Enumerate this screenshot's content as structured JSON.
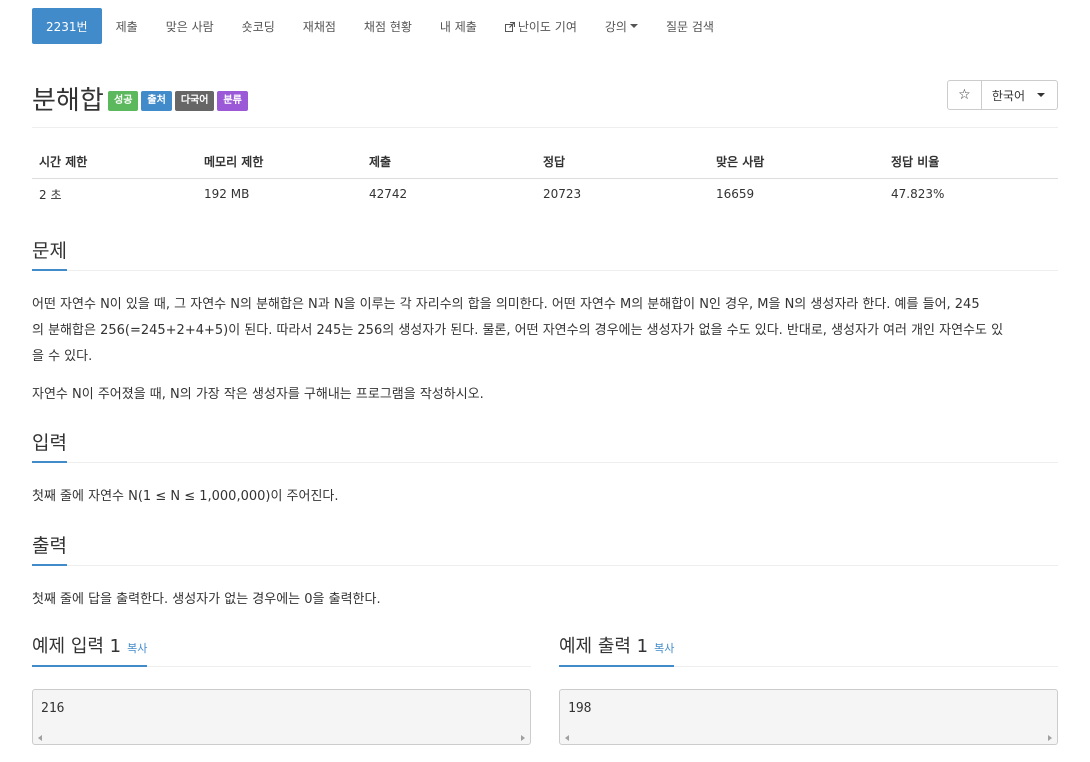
{
  "nav": {
    "items": [
      {
        "label": "2231번"
      },
      {
        "label": "제출"
      },
      {
        "label": "맞은 사람"
      },
      {
        "label": "숏코딩"
      },
      {
        "label": "재채점"
      },
      {
        "label": "채점 현황"
      },
      {
        "label": "내 제출"
      },
      {
        "label": "난이도 기여",
        "icon": "external-link-icon"
      },
      {
        "label": "강의",
        "icon": "caret-down-icon"
      },
      {
        "label": "질문 검색"
      }
    ]
  },
  "problem": {
    "title": "분해합",
    "labels": [
      "성공",
      "출처",
      "다국어",
      "분류"
    ],
    "star": "☆",
    "language": "한국어"
  },
  "info": {
    "headers": [
      "시간 제한",
      "메모리 제한",
      "제출",
      "정답",
      "맞은 사람",
      "정답 비율"
    ],
    "values": [
      "2 초",
      "192 MB",
      "42742",
      "20723",
      "16659",
      "47.823%"
    ]
  },
  "description": {
    "heading": "문제",
    "p1_line1": "어떤 자연수 N이 있을 때, 그 자연수 N의 분해합은 N과 N을 이루는 각 자리수의 합을 의미한다. 어떤 자연수 M의 분해합이 N인 경우, M을 N의 생성자라 한다. 예를 들어, 245",
    "p1_line2": "의 분해합은 256(=245+2+4+5)이 된다. 따라서 245는 256의 생성자가 된다. 물론, 어떤 자연수의 경우에는 생성자가 없을 수도 있다. 반대로, 생성자가 여러 개인 자연수도 있",
    "p1_line3": "을 수 있다.",
    "p2": "자연수 N이 주어졌을 때, N의 가장 작은 생성자를 구해내는 프로그램을 작성하시오."
  },
  "input": {
    "heading": "입력",
    "text": "첫째 줄에 자연수 N(1 ≤ N ≤ 1,000,000)이 주어진다."
  },
  "output": {
    "heading": "출력",
    "text": "첫째 줄에 답을 출력한다. 생성자가 없는 경우에는 0을 출력한다."
  },
  "samples": {
    "input_heading": "예제 입력 1",
    "output_heading": "예제 출력 1",
    "copy_label": "복사",
    "input_value": "216",
    "output_value": "198"
  }
}
